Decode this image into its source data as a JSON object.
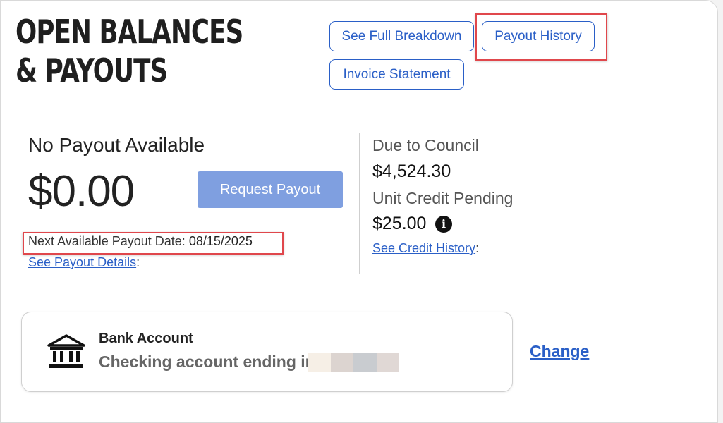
{
  "header": {
    "title": "OPEN BALANCES & PAYOUTS",
    "buttons": {
      "full_breakdown": "See Full Breakdown",
      "payout_history": "Payout History",
      "invoice_statement": "Invoice Statement"
    }
  },
  "payout": {
    "heading": "No Payout Available",
    "amount": "$0.00",
    "request_button": "Request Payout",
    "next_date_label": "Next Available Payout Date: ",
    "next_date_value": "08/15/2025",
    "details_link": "See Payout Details",
    "details_suffix": ":"
  },
  "council": {
    "due_label": "Due to Council",
    "due_value": "$4,524.30",
    "credit_label": "Unit Credit Pending",
    "credit_value": "$25.00",
    "info_icon": "info-icon",
    "credit_history_link": "See Credit History",
    "credit_history_suffix": ":"
  },
  "bank": {
    "icon": "bank-icon",
    "title": "Bank Account",
    "subtitle": "Checking account ending in",
    "change_link": "Change"
  },
  "colors": {
    "accent": "#2a5fc7",
    "disabled_button": "#7f9fe0",
    "highlight": "#e0474c"
  }
}
